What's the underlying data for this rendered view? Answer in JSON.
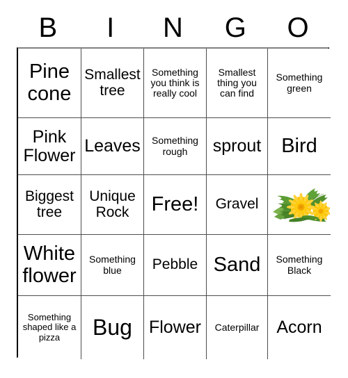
{
  "card": {
    "title": "BINGO",
    "header_letters": [
      "B",
      "I",
      "N",
      "G",
      "O"
    ],
    "free_space_label": "Free!",
    "grid": {
      "columns": 5,
      "rows": 5,
      "border_color": "#000000",
      "grid_line_color": "#4d4d4d",
      "background_color": "#ffffff",
      "text_color": "#000000"
    },
    "cells": [
      [
        {
          "text": "Pine cone",
          "size": "xl",
          "type": "text"
        },
        {
          "text": "Smallest tree",
          "size": "md",
          "type": "text"
        },
        {
          "text": "Something you think is really cool",
          "size": "sm",
          "type": "text"
        },
        {
          "text": "Smallest thing you can find",
          "size": "sm",
          "type": "text"
        },
        {
          "text": "Something green",
          "size": "sm",
          "type": "text"
        }
      ],
      [
        {
          "text": "Pink Flower",
          "size": "lg",
          "type": "text"
        },
        {
          "text": "Leaves",
          "size": "lg",
          "type": "text"
        },
        {
          "text": "Something rough",
          "size": "sm",
          "type": "text"
        },
        {
          "text": "sprout",
          "size": "lg",
          "type": "text"
        },
        {
          "text": "Bird",
          "size": "xl",
          "type": "text"
        }
      ],
      [
        {
          "text": "Biggest tree",
          "size": "md",
          "type": "text"
        },
        {
          "text": "Unique Rock",
          "size": "md",
          "type": "text"
        },
        {
          "text": "Free!",
          "size": "xl",
          "type": "text"
        },
        {
          "text": "Gravel",
          "size": "md",
          "type": "text"
        },
        {
          "text": "",
          "size": "sm",
          "type": "image",
          "image": "dandelion-photo",
          "image_alt": "Two yellow dandelion flowers with green leaves"
        }
      ],
      [
        {
          "text": "White flower",
          "size": "xl",
          "type": "text"
        },
        {
          "text": "Something blue",
          "size": "sm",
          "type": "text"
        },
        {
          "text": "Pebble",
          "size": "md",
          "type": "text"
        },
        {
          "text": "Sand",
          "size": "xl",
          "type": "text"
        },
        {
          "text": "Something Black",
          "size": "sm",
          "type": "text"
        }
      ],
      [
        {
          "text": "Something shaped like a pizza",
          "size": "xs",
          "type": "text"
        },
        {
          "text": "Bug",
          "size": "xxl",
          "type": "text"
        },
        {
          "text": "Flower",
          "size": "lg",
          "type": "text"
        },
        {
          "text": "Caterpillar",
          "size": "sm",
          "type": "text"
        },
        {
          "text": "Acorn",
          "size": "lg",
          "type": "text"
        }
      ]
    ],
    "colors": {
      "dandelion_petal": "#ffc800",
      "dandelion_petal_light": "#ffd633",
      "dandelion_center": "#f0a800",
      "leaf_green": "#4e8c2a",
      "leaf_green_light": "#76b24a",
      "leaf_green_dark": "#356b1d"
    }
  }
}
